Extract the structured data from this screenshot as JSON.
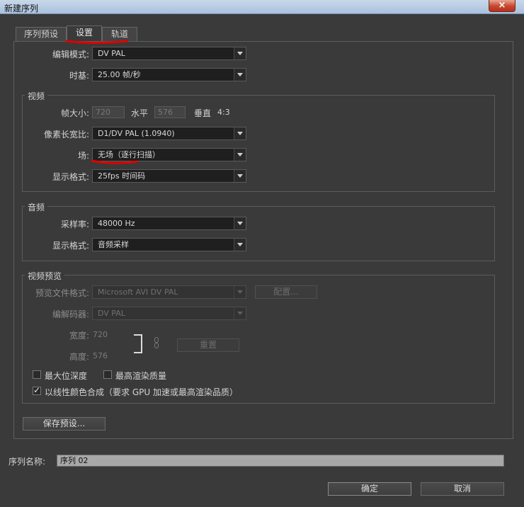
{
  "window": {
    "title": "新建序列",
    "close_glyph": "×"
  },
  "tabs": [
    {
      "label": "序列预设",
      "active": false
    },
    {
      "label": "设置",
      "active": true
    },
    {
      "label": "轨道",
      "active": false
    }
  ],
  "general": {
    "editing_mode_label": "编辑模式:",
    "editing_mode_value": "DV PAL",
    "timebase_label": "时基:",
    "timebase_value": "25.00 帧/秒"
  },
  "video": {
    "title": "视频",
    "frame_size_label": "帧大小:",
    "frame_width": "720",
    "horizontal_label": "水平",
    "frame_height": "576",
    "vertical_label": "垂直",
    "aspect": "4:3",
    "pixel_aspect_label": "像素长宽比:",
    "pixel_aspect_value": "D1/DV PAL (1.0940)",
    "fields_label": "场:",
    "fields_value": "无场（逐行扫描）",
    "display_format_label": "显示格式:",
    "display_format_value": "25fps 时间码"
  },
  "audio": {
    "title": "音频",
    "sample_rate_label": "采样率:",
    "sample_rate_value": "48000 Hz",
    "display_format_label": "显示格式:",
    "display_format_value": "音频采样"
  },
  "preview": {
    "title": "视频预览",
    "file_format_label": "预览文件格式:",
    "file_format_value": "Microsoft AVI DV PAL",
    "configure_label": "配置...",
    "codec_label": "编解码器:",
    "codec_value": "DV PAL",
    "width_label": "宽度:",
    "width_value": "720",
    "height_label": "高度:",
    "height_value": "576",
    "reset_label": "重置",
    "max_bit_depth_label": "最大位深度",
    "max_render_quality_label": "最高渲染质量",
    "linear_color_label": "以线性颜色合成（要求 GPU 加速或最高渲染品质）"
  },
  "save_preset_label": "保存预设...",
  "sequence_name_label": "序列名称:",
  "sequence_name_value": "序列 02",
  "ok_label": "确定",
  "cancel_label": "取消",
  "colors": {
    "annotation": "#e00000",
    "titlebar": "#b6cbe4",
    "background": "#3a3a3a"
  }
}
